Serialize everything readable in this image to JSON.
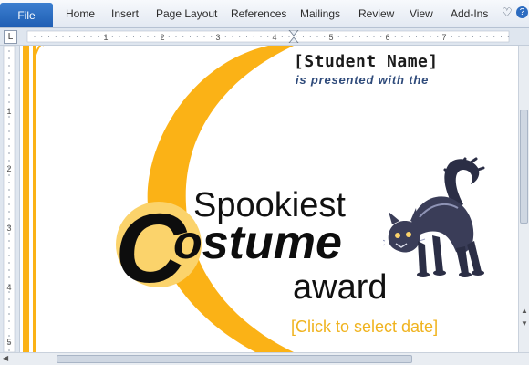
{
  "ribbon": {
    "file_label": "File",
    "tabs": [
      {
        "label": "Home"
      },
      {
        "label": "Insert"
      },
      {
        "label": "Page Layout"
      },
      {
        "label": "References"
      },
      {
        "label": "Mailings"
      },
      {
        "label": "Review"
      },
      {
        "label": "View"
      },
      {
        "label": "Add-Ins"
      }
    ],
    "icons": [
      "chevron-down-icon",
      "help-icon"
    ]
  },
  "ruler": {
    "tab_selector": "L",
    "h_labels": [
      "1",
      "2",
      "3",
      "4",
      "5",
      "6",
      "7"
    ],
    "v_labels": [
      "1",
      "2",
      "3",
      "4",
      "5"
    ]
  },
  "certificate": {
    "student_name": "[Student Name]",
    "presented_text": "is presented with the",
    "line1": "Spookiest",
    "costume_initial": "C",
    "costume_rest": "ostume",
    "line3": "award",
    "date_placeholder": "[Click to select date]"
  },
  "colors": {
    "accent_orange": "#fbb216",
    "light_orange": "#fbd36b",
    "presented_blue": "#2e4a7a",
    "file_tab_blue": "#2a6cc4"
  }
}
